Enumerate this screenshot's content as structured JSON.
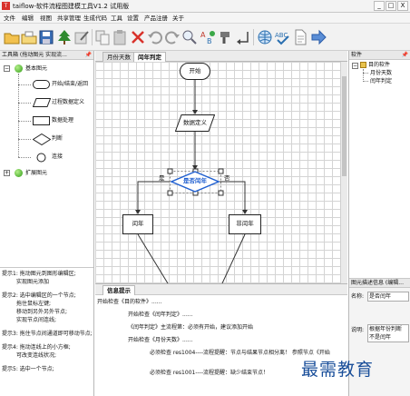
{
  "window": {
    "icon_text": "T",
    "title": "taiflow-软件流程图建模工具V1.2 试用版",
    "minimize": "_",
    "maximize": "□",
    "close": "X"
  },
  "menu": [
    "文件",
    "编辑",
    "视图",
    "共享管理",
    "生成代码",
    "工具",
    "设置",
    "产品注册",
    "关于"
  ],
  "toolbar": [
    "open-folder-icon",
    "open-file-icon",
    "save-icon",
    "tree-icon",
    "edit-icon",
    "copy-icon",
    "paste-icon",
    "delete-icon",
    "undo-icon",
    "redo-icon",
    "zoom-icon",
    "code-generate-icon",
    "paint-icon",
    "arrow-corner-icon",
    "globe-icon",
    "spell-check-icon",
    "document-icon",
    "forward-arrow-icon"
  ],
  "left_panel": {
    "header": "工具箱 (拖动图元 实现流...",
    "pin": "📌",
    "root_basic": "基本图元",
    "items": [
      "开始/结束/返回",
      "过程数据定义",
      "数据处理",
      "判断",
      "连接"
    ],
    "root_extended": "扩展图元",
    "hints": [
      "提示1: 拖动图元到图形编辑区;",
      "实现图元添加",
      "提示2: 选中编辑区的一个节点;",
      "拖住鼠标左键;",
      "移动到另外另外节点;",
      "实现节点间连线;",
      "提示3: 拖住节点间通道即可移动节点;",
      "提示4: 拖动连线上的小方框;",
      "可改变连线状况;",
      "提示5: 选中一个节点;"
    ]
  },
  "canvas": {
    "tabs": [
      "月份天数",
      "闰年判定"
    ],
    "active_tab": 1,
    "nodes": {
      "start": "开始",
      "data_def": "数据定义",
      "decision": "是否闰年",
      "leap": "闰年",
      "not_leap": "非闰年"
    },
    "branch_yes": "是",
    "branch_no": "否"
  },
  "right_panel": {
    "header": "软件",
    "pin": "📌",
    "tree_root": "目的软件",
    "tree_items": [
      "月份天数",
      "闰年判定"
    ],
    "prop_header": "图元描述信息 (编辑...",
    "name_label": "名称:",
    "name_value": "是否闰年",
    "desc_label": "说明:",
    "desc_value": "根据年份判断\n不是闰年"
  },
  "bottom_panel": {
    "tab": "信息提示",
    "lines": [
      "开始检查《目的软件》......",
      "开始检查《闰年判定》......",
      "《闰年判定》主流程第：必须有开始，建议添加开始",
      "开始检查《月份天数》......",
      "必须检查 res1004----流程提醒：节点与结果节点相分离！ 参照节点《开始",
      "必须检查 res1001----流程提醒：缺少结束节点！"
    ]
  },
  "watermark": "最需教育"
}
